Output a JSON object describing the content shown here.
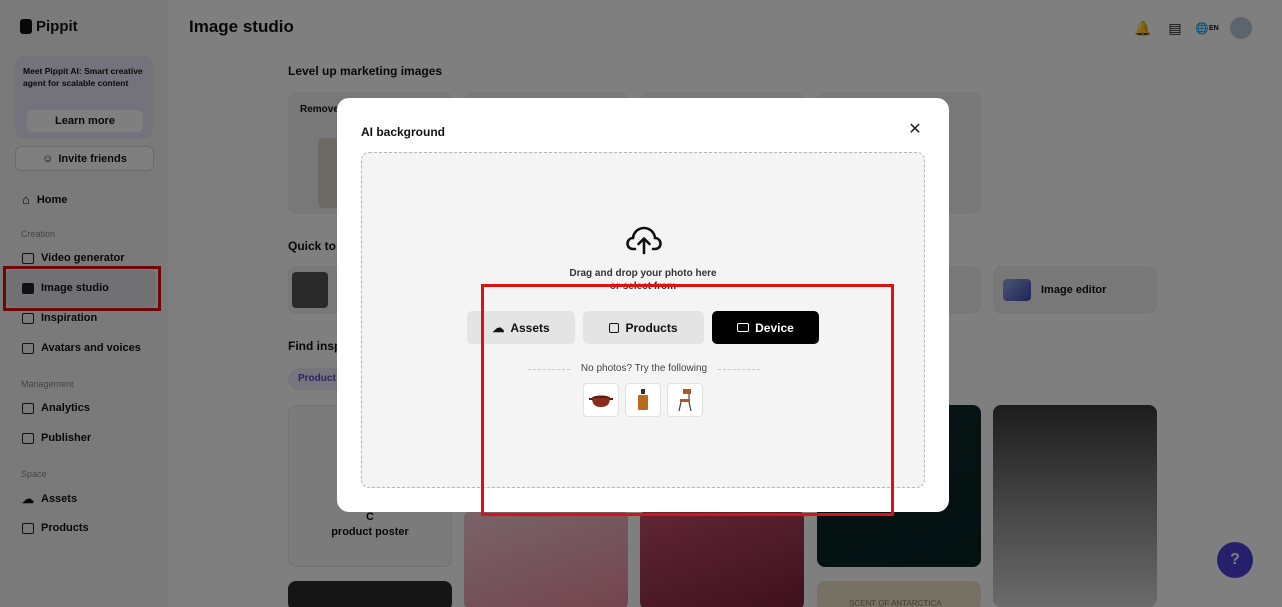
{
  "app": {
    "name": "Pippit"
  },
  "sidebar": {
    "promo": {
      "text": "Meet Pippit AI: Smart creative agent for scalable content",
      "button": "Learn more"
    },
    "invite": "Invite friends",
    "home": "Home",
    "sections": {
      "creation": "Creation",
      "management": "Management",
      "space": "Space"
    },
    "items": {
      "video_generator": "Video generator",
      "image_studio": "Image studio",
      "inspiration": "Inspiration",
      "avatars": "Avatars and voices",
      "analytics": "Analytics",
      "publisher": "Publisher",
      "assets": "Assets",
      "products": "Products"
    },
    "active": "Image studio"
  },
  "header": {
    "title": "Image studio",
    "language": "EN"
  },
  "main": {
    "section_level_up": "Level up marketing images",
    "card_remove_partial": "Remove",
    "section_quick_partial": "Quick to",
    "image_editor": "Image editor",
    "section_find_partial": "Find insp",
    "pill_partial": "Product",
    "poster_partial_line1": "C",
    "poster_line2": "product poster",
    "antarctica_partial": "SCENT OF ANTARCTICA"
  },
  "modal": {
    "title": "AI background",
    "drop_line1": "Drag and drop your photo here",
    "drop_line2": "or select from",
    "buttons": {
      "assets": "Assets",
      "products": "Products",
      "device": "Device"
    },
    "samples_label": "No photos? Try the following",
    "samples": [
      "pot-sample",
      "perfume-sample",
      "chair-sample"
    ]
  },
  "colors": {
    "accent": "#4b3fd9",
    "highlight": "#dd1111",
    "device_button": "#000000"
  }
}
